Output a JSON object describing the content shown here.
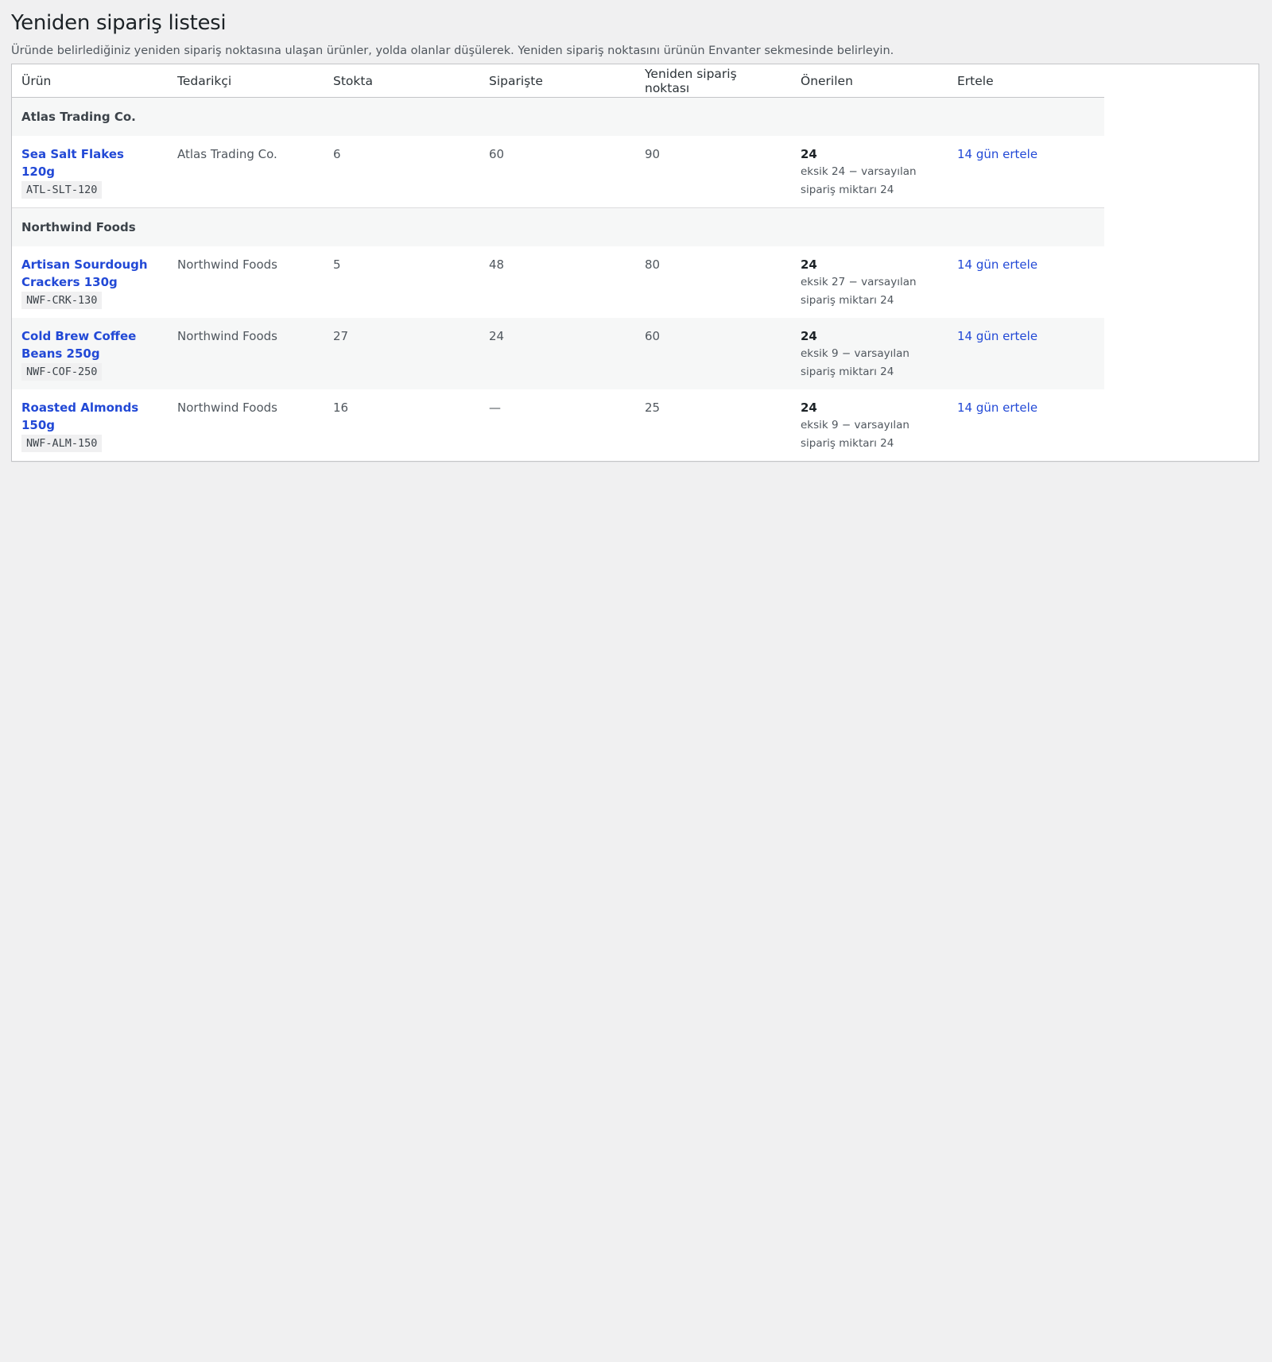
{
  "page": {
    "title": "Yeniden sipariş listesi",
    "description": "Üründe belirlediğiniz yeniden sipariş noktasına ulaşan ürünler, yolda olanlar düşülerek. Yeniden sipariş noktasını ürünün Envanter sekmesinde belirleyin."
  },
  "table": {
    "columns": [
      "Ürün",
      "Tedarikçi",
      "Stokta",
      "Siparişte",
      "Yeniden sipariş noktası",
      "Önerilen",
      "Ertele"
    ],
    "groups": [
      {
        "name": "Atlas Trading Co.",
        "rows": [
          {
            "product": "Sea Salt Flakes 120g",
            "sku": "ATL-SLT-120",
            "supplier": "Atlas Trading Co.",
            "in_stock": "6",
            "on_order": "60",
            "reorder_point": "90",
            "suggested": "24",
            "suggested_note": "eksik 24 − varsayılan sipariş miktarı 24",
            "snooze": "14 gün ertele"
          }
        ]
      },
      {
        "name": "Northwind Foods",
        "rows": [
          {
            "product": "Artisan Sourdough Crackers 130g",
            "sku": "NWF-CRK-130",
            "supplier": "Northwind Foods",
            "in_stock": "5",
            "on_order": "48",
            "reorder_point": "80",
            "suggested": "24",
            "suggested_note": "eksik 27 − varsayılan sipariş miktarı 24",
            "snooze": "14 gün ertele"
          },
          {
            "product": "Cold Brew Coffee Beans 250g",
            "sku": "NWF-COF-250",
            "supplier": "Northwind Foods",
            "in_stock": "27",
            "on_order": "24",
            "reorder_point": "60",
            "suggested": "24",
            "suggested_note": "eksik 9 − varsayılan sipariş miktarı 24",
            "snooze": "14 gün ertele"
          },
          {
            "product": "Roasted Almonds 150g",
            "sku": "NWF-ALM-150",
            "supplier": "Northwind Foods",
            "in_stock": "16",
            "on_order": "—",
            "reorder_point": "25",
            "suggested": "24",
            "suggested_note": "eksik 9 − varsayılan sipariş miktarı 24",
            "snooze": "14 gün ertele"
          }
        ]
      }
    ]
  },
  "colors": {
    "link": "#2249d6",
    "background": "#f0f0f1",
    "panel": "#ffffff",
    "group_bg": "#f6f7f7",
    "border": "#c3c4c7"
  }
}
